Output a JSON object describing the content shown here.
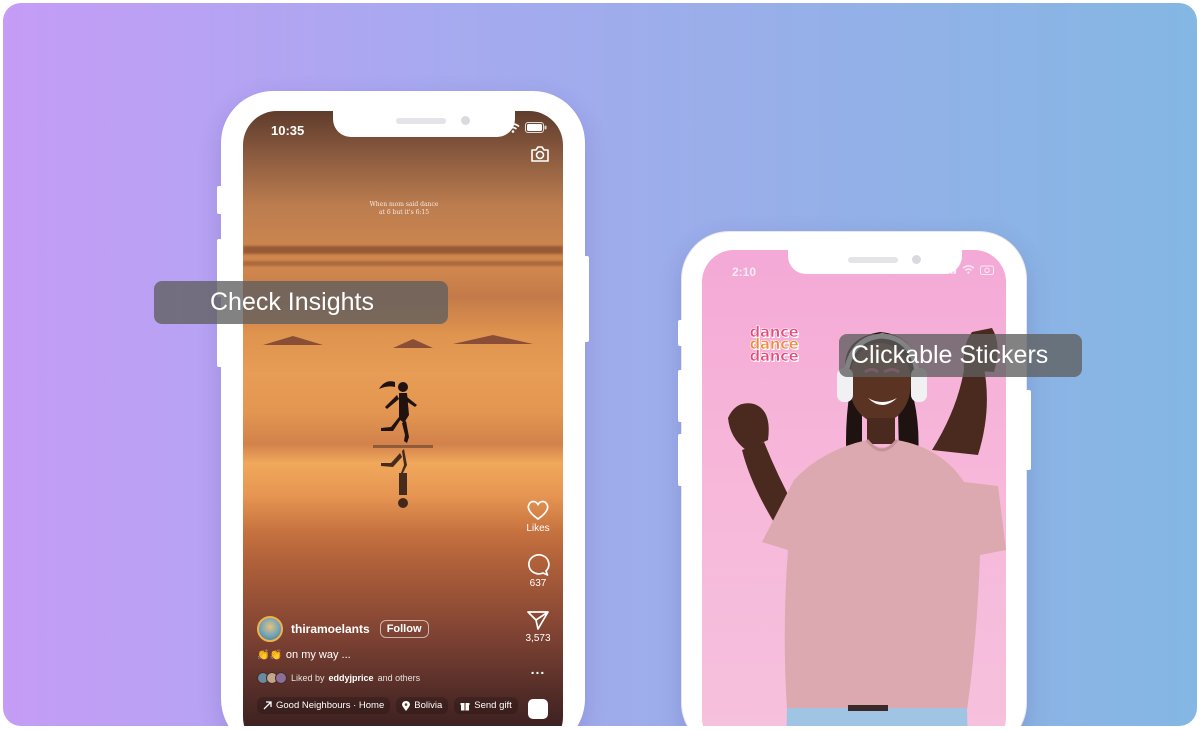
{
  "left_phone": {
    "status_time": "10:35",
    "overlay_text": "When mom said dance at 6 but it's 6:15",
    "rail": {
      "likes_label": "Likes",
      "comments_count": "637",
      "shares_count": "3,573",
      "more_label": "..."
    },
    "post": {
      "username": "thiramoelants",
      "follow_label": "Follow",
      "caption_emoji": "👏👏",
      "caption": "on my way ...",
      "liked_prefix": "Liked by",
      "liked_user": "eddyjprice",
      "liked_suffix": "and others",
      "chips": [
        {
          "icon": "arrow-icon",
          "label": "Good Neighbours · Home"
        },
        {
          "icon": "location-pin-icon",
          "label": "Bolivia"
        },
        {
          "icon": "gift-icon",
          "label": "Send gift"
        }
      ]
    }
  },
  "right_phone": {
    "status_time": "2:10",
    "sticker_lines": [
      "dance",
      "dance",
      "dance"
    ]
  },
  "labels": {
    "insights": "Check Insights",
    "stickers": "Clickable Stickers"
  },
  "colors": {
    "label_bg": "#5f5f5f",
    "gradient_start": "#c59cf6",
    "gradient_end": "#84b7e3",
    "sticker_pink": "#e64a7a",
    "sticker_orange": "#f08a3c",
    "right_screen_bg": "#f4a9d6"
  }
}
